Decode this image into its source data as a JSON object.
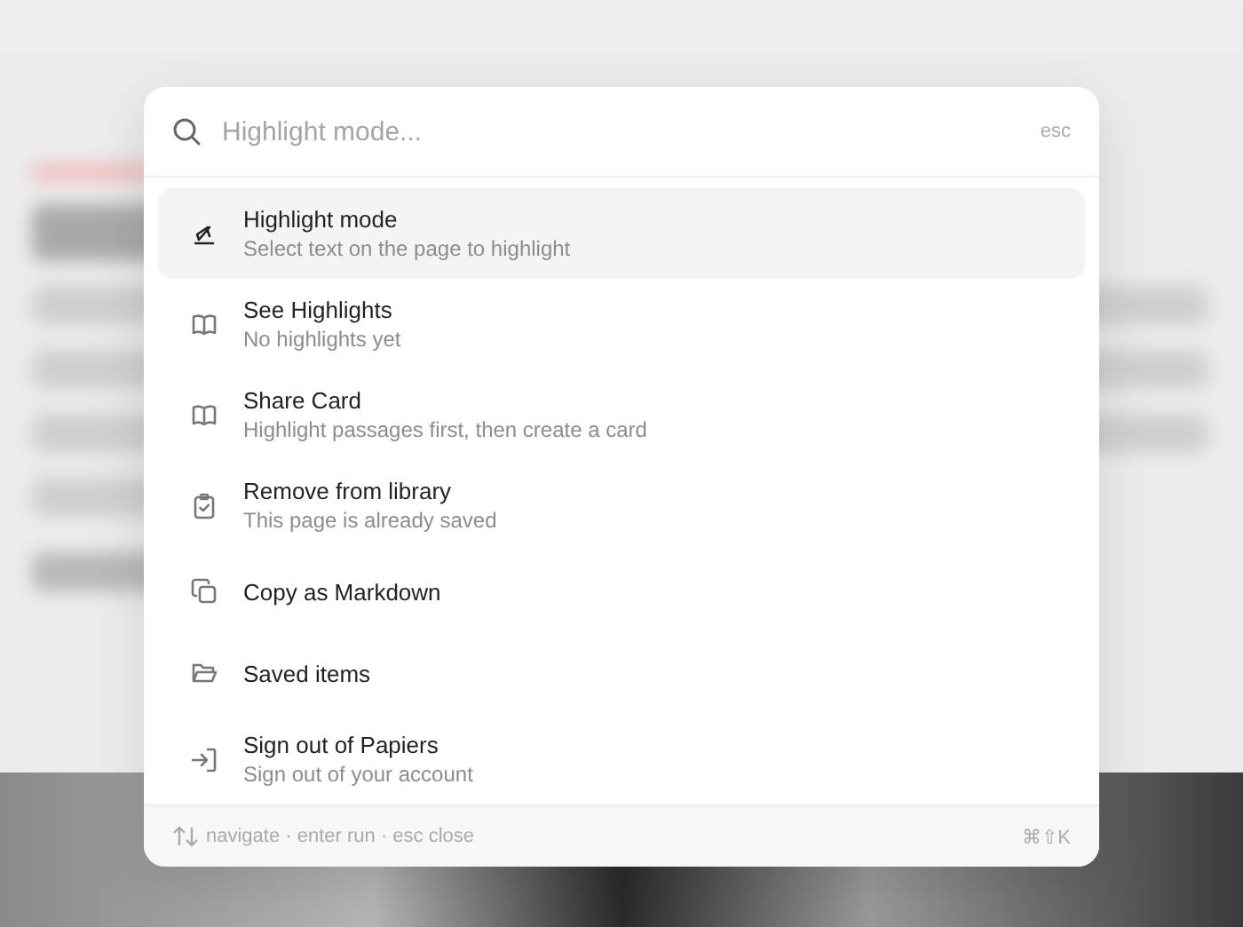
{
  "search": {
    "placeholder": "Highlight mode...",
    "shortcut": "esc"
  },
  "commands": [
    {
      "title": "Highlight mode",
      "subtitle": "Select text on the page to highlight",
      "selected": true
    },
    {
      "title": "See Highlights",
      "subtitle": "No highlights yet",
      "selected": false
    },
    {
      "title": "Share Card",
      "subtitle": "Highlight passages first, then create a card",
      "selected": false
    },
    {
      "title": "Remove from library",
      "subtitle": "This page is already saved",
      "selected": false
    },
    {
      "title": "Copy as Markdown",
      "selected": false
    },
    {
      "title": "Saved items",
      "selected": false
    },
    {
      "title": "Sign out of Papiers",
      "subtitle": "Sign out of your account",
      "selected": false
    }
  ],
  "footer": {
    "hints": "navigate · enter run · esc close",
    "shortcut": "⌘⇧K"
  }
}
